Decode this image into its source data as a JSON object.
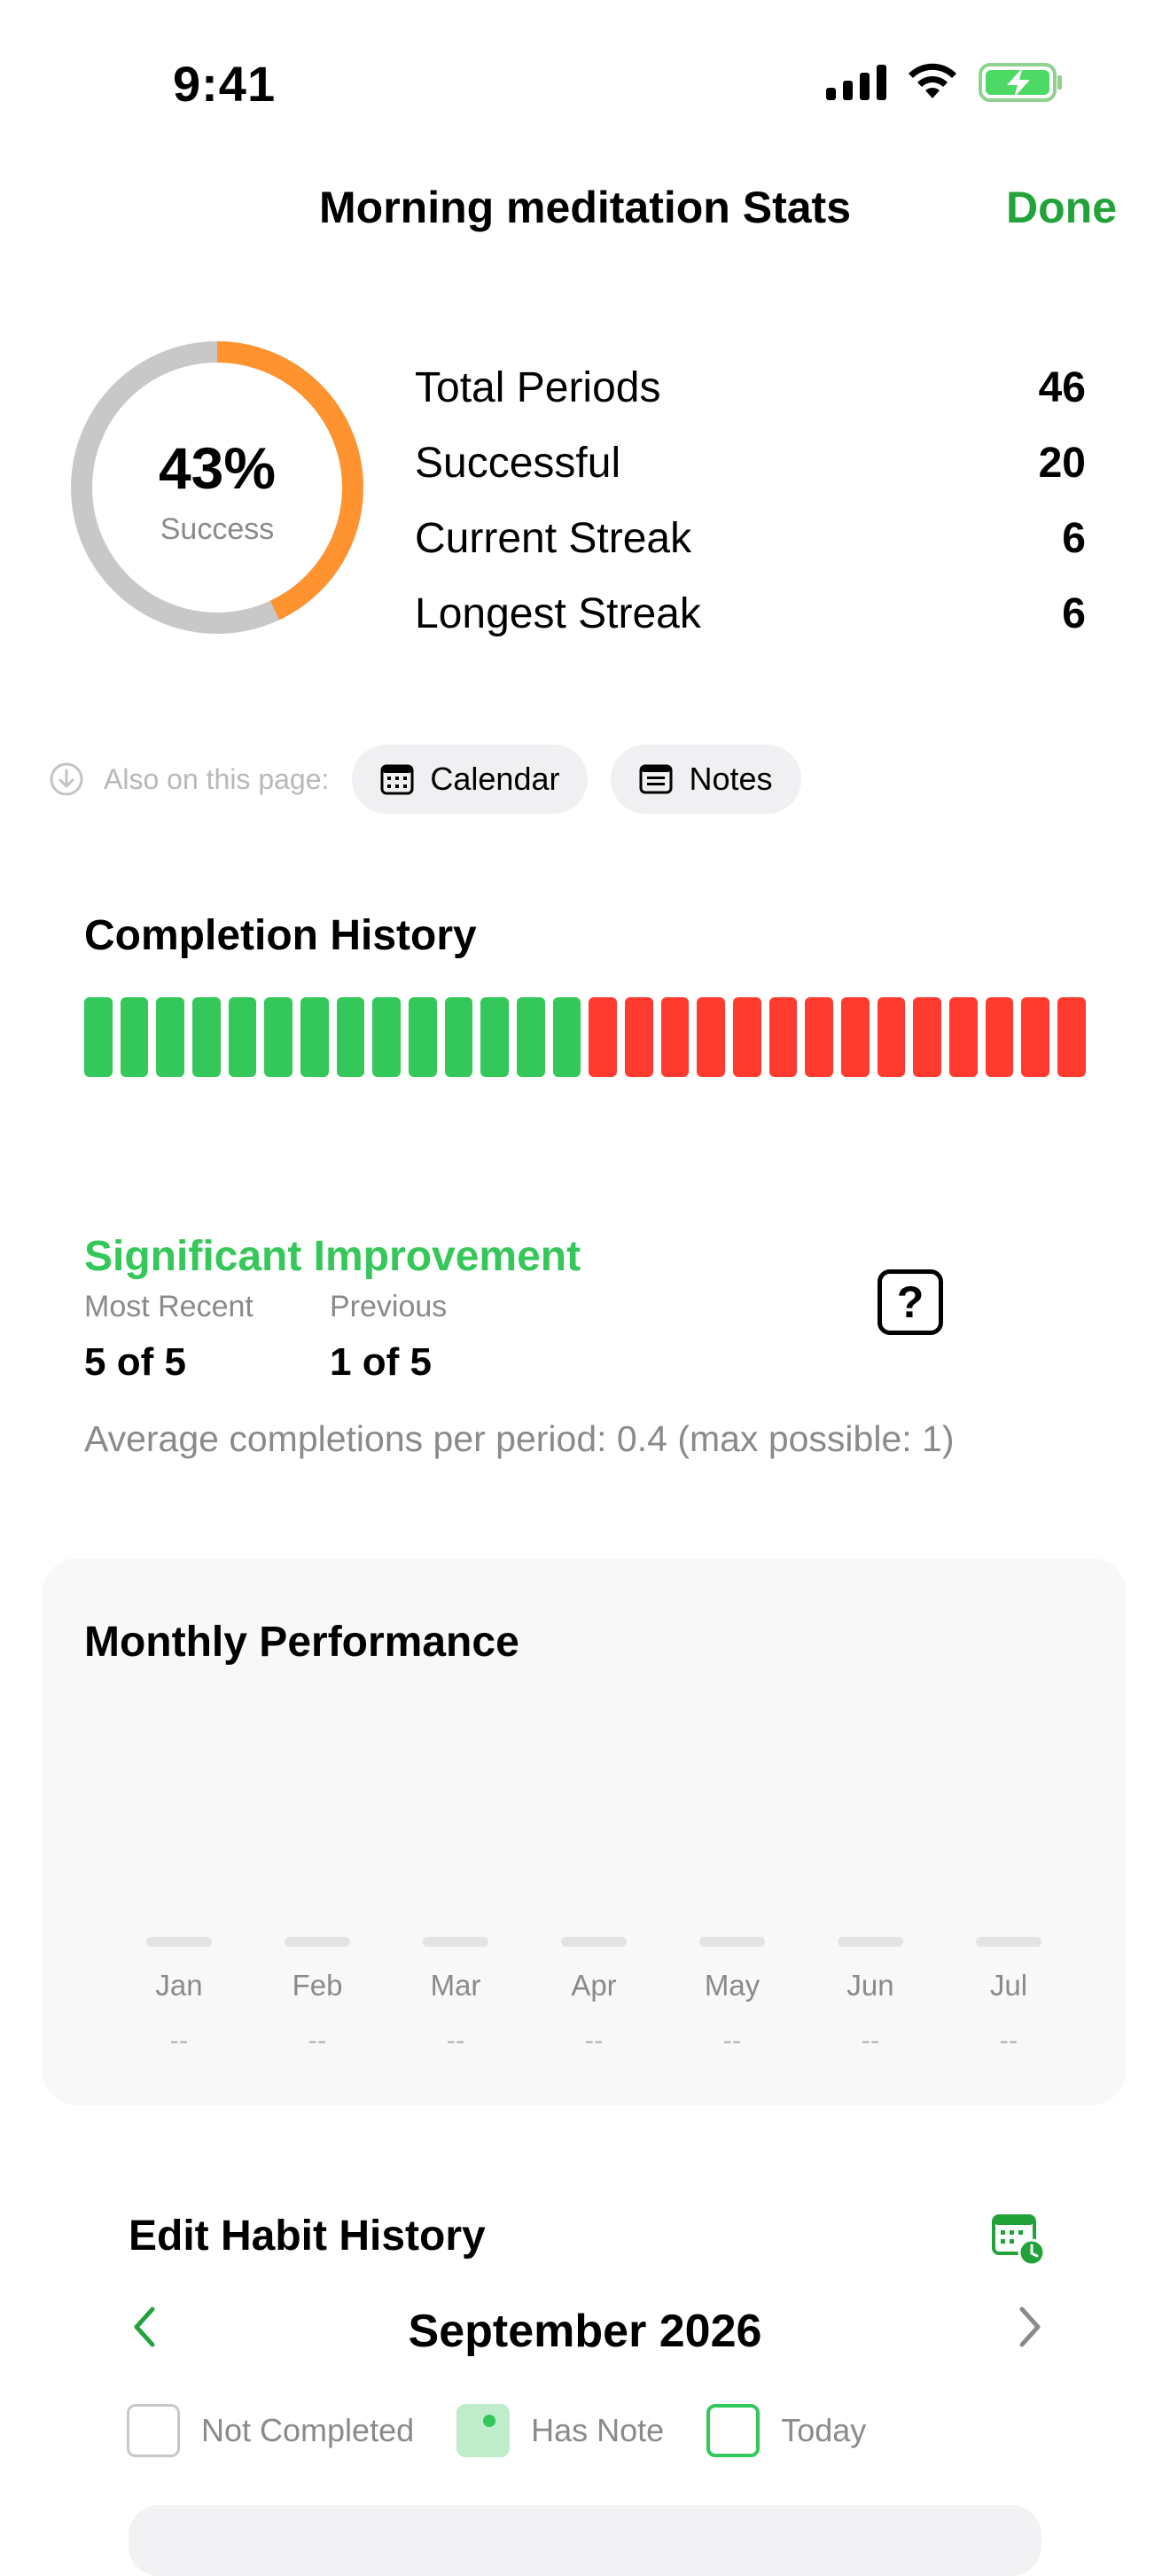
{
  "status_bar": {
    "time": "9:41"
  },
  "header": {
    "title": "Morning meditation Stats",
    "done_label": "Done"
  },
  "summary": {
    "success_percent": "43%",
    "success_label": "Success",
    "success_fraction": 0.43,
    "stats": [
      {
        "label": "Total Periods",
        "value": "46"
      },
      {
        "label": "Successful",
        "value": "20"
      },
      {
        "label": "Current Streak",
        "value": "6"
      },
      {
        "label": "Longest Streak",
        "value": "6"
      }
    ]
  },
  "also_on_page": {
    "label": "Also on this page:",
    "chips": [
      {
        "label": "Calendar",
        "icon": "calendar-icon"
      },
      {
        "label": "Notes",
        "icon": "notes-icon"
      }
    ]
  },
  "completion_history": {
    "title": "Completion History",
    "bars": [
      "s",
      "s",
      "s",
      "s",
      "s",
      "s",
      "s",
      "s",
      "s",
      "s",
      "s",
      "s",
      "s",
      "s",
      "f",
      "f",
      "f",
      "f",
      "f",
      "f",
      "f",
      "f",
      "f",
      "f",
      "f",
      "f",
      "f",
      "f"
    ],
    "colors": {
      "success": "#34c759",
      "fail": "#ff3b30"
    }
  },
  "improvement": {
    "title": "Significant Improvement",
    "most_recent_label": "Most Recent",
    "most_recent_value": "5 of 5",
    "previous_label": "Previous",
    "previous_value": "1 of 5",
    "help_label": "?",
    "average_text": "Average completions per period: 0.4 (max possible: 1)"
  },
  "monthly_performance": {
    "title": "Monthly Performance",
    "months": [
      {
        "label": "Jan",
        "value": "--"
      },
      {
        "label": "Feb",
        "value": "--"
      },
      {
        "label": "Mar",
        "value": "--"
      },
      {
        "label": "Apr",
        "value": "--"
      },
      {
        "label": "May",
        "value": "--"
      },
      {
        "label": "Jun",
        "value": "--"
      },
      {
        "label": "Jul",
        "value": "--"
      }
    ]
  },
  "edit_history": {
    "title": "Edit Habit History",
    "month": "September 2026",
    "legend": [
      {
        "label": "Not Completed"
      },
      {
        "label": "Has Note"
      },
      {
        "label": "Today"
      }
    ]
  },
  "colors": {
    "accent": "#22a33a",
    "ring_track": "#c8c8c8",
    "ring_fill": "#ff9330"
  }
}
